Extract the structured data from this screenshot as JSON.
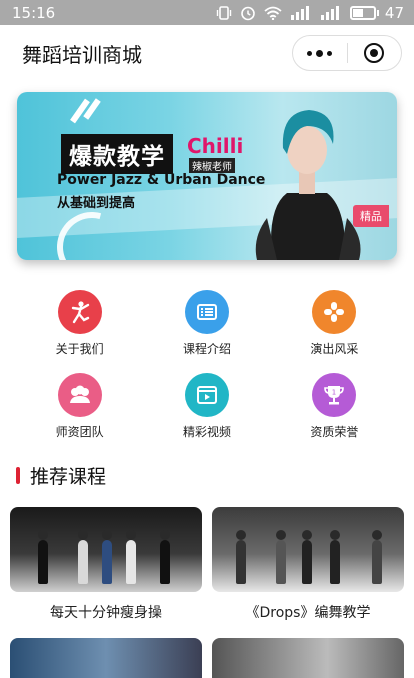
{
  "status_bar": {
    "time": "15:16",
    "battery": "47"
  },
  "header": {
    "title": "舞蹈培训商城"
  },
  "banner": {
    "tag": "爆款教学",
    "name": "Chilli",
    "name_sub": "辣椒老师",
    "line1": "Power Jazz & Urban Dance",
    "line2": "从基础到提高",
    "badge": "精品"
  },
  "menu": [
    {
      "label": "关于我们",
      "icon": "dancer-icon",
      "color": "#e8404a"
    },
    {
      "label": "课程介绍",
      "icon": "list-icon",
      "color": "#3aa0ea"
    },
    {
      "label": "演出风采",
      "icon": "flower-icon",
      "color": "#f0862c"
    },
    {
      "label": "师资团队",
      "icon": "team-icon",
      "color": "#ea5d86"
    },
    {
      "label": "精彩视频",
      "icon": "video-icon",
      "color": "#21b6c6"
    },
    {
      "label": "资质荣誉",
      "icon": "trophy-icon",
      "color": "#b55bd6"
    }
  ],
  "section": {
    "title": "推荐课程",
    "accent": "#d22233"
  },
  "courses": [
    {
      "title": "每天十分钟瘦身操"
    },
    {
      "title": "《Drops》编舞教学"
    }
  ]
}
